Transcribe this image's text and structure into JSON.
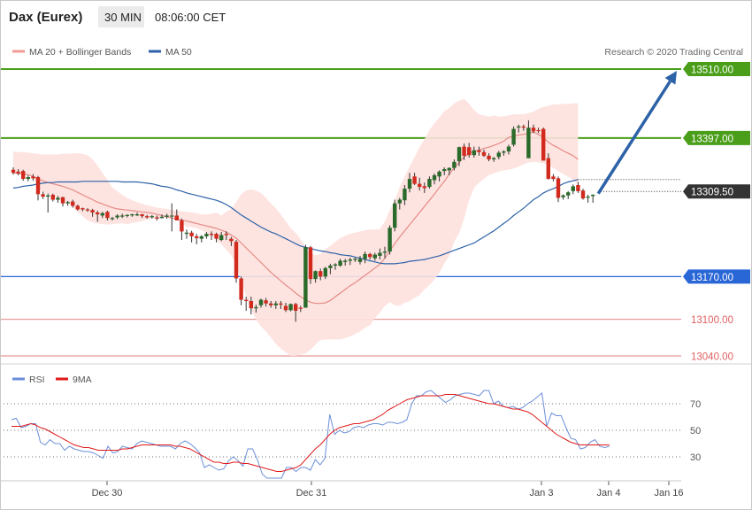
{
  "header": {
    "symbol": "Dax (Eurex)",
    "interval": "30 MIN",
    "time": "08:06:00 CET"
  },
  "legend": {
    "bollinger_label": "MA 20 + Bollinger Bands",
    "ma50_label": "MA 50",
    "credit": "Research © 2020 Trading Central"
  },
  "colors": {
    "bullish": "#2a6a2a",
    "bearish": "#d32a1e",
    "band_fill": "#fde1de",
    "ma20": "#e68a85",
    "ma50": "#2d62a8",
    "target_line": "#4a9e1a",
    "support_line": "#2a67d6",
    "lower_line": "#e89b98",
    "arrow": "#2d62a8",
    "rsi": "#6b8fd8",
    "rsi_ma": "#e01a1a"
  },
  "price_levels": [
    {
      "label": "13510.00",
      "value": 13510,
      "style": "target"
    },
    {
      "label": "13397.00",
      "value": 13397,
      "style": "target"
    },
    {
      "label": "13309.50",
      "value": 13309.5,
      "style": "last"
    },
    {
      "label": "13170.00",
      "value": 13170,
      "style": "support"
    },
    {
      "label": "13100.00",
      "value": 13100,
      "style": "lower"
    },
    {
      "label": "13040.00",
      "value": 13040,
      "style": "lower"
    }
  ],
  "rsi_panel": {
    "rsi_label": "RSI",
    "ma_label": "9MA",
    "ticks": [
      "70",
      "50",
      "30"
    ]
  },
  "x_axis": {
    "labels": [
      "Dec 30",
      "Dec 31",
      "Jan 3",
      "Jan 4",
      "Jan 16"
    ]
  },
  "chart_data": {
    "type": "candlestick",
    "price_range": [
      13025,
      13530
    ],
    "rsi_range": [
      10,
      90
    ],
    "ohlc": [
      [
        13345,
        13349,
        13337,
        13340
      ],
      [
        13342,
        13346,
        13336,
        13339
      ],
      [
        13343,
        13345,
        13327,
        13330
      ],
      [
        13330,
        13336,
        13326,
        13333
      ],
      [
        13334,
        13338,
        13327,
        13331
      ],
      [
        13333,
        13335,
        13295,
        13305
      ],
      [
        13305,
        13309,
        13297,
        13301
      ],
      [
        13301,
        13306,
        13275,
        13303
      ],
      [
        13304,
        13306,
        13293,
        13296
      ],
      [
        13296,
        13302,
        13291,
        13299
      ],
      [
        13300,
        13301,
        13285,
        13290
      ],
      [
        13290,
        13294,
        13286,
        13292
      ],
      [
        13293,
        13296,
        13283,
        13286
      ],
      [
        13286,
        13288,
        13278,
        13280
      ],
      [
        13282,
        13283,
        13277,
        13280
      ],
      [
        13280,
        13282,
        13276,
        13279
      ],
      [
        13279,
        13281,
        13268,
        13275
      ],
      [
        13275,
        13278,
        13260,
        13272
      ],
      [
        13270,
        13276,
        13266,
        13274
      ],
      [
        13276,
        13278,
        13262,
        13266
      ],
      [
        13265,
        13268,
        13262,
        13266
      ],
      [
        13267,
        13272,
        13264,
        13270
      ],
      [
        13270,
        13273,
        13266,
        13270
      ],
      [
        13270,
        13272,
        13267,
        13271
      ],
      [
        13271,
        13273,
        13268,
        13272
      ],
      [
        13272,
        13275,
        13269,
        13272
      ],
      [
        13272,
        13273,
        13266,
        13269
      ],
      [
        13269,
        13271,
        13265,
        13267
      ],
      [
        13268,
        13271,
        13265,
        13269
      ],
      [
        13267,
        13270,
        13262,
        13265
      ],
      [
        13266,
        13272,
        13265,
        13268
      ],
      [
        13268,
        13273,
        13265,
        13270
      ],
      [
        13270,
        13290,
        13244,
        13270
      ],
      [
        13270,
        13280,
        13262,
        13262
      ],
      [
        13262,
        13265,
        13230,
        13244
      ],
      [
        13240,
        13247,
        13232,
        13242
      ],
      [
        13242,
        13245,
        13226,
        13236
      ],
      [
        13236,
        13240,
        13223,
        13233
      ],
      [
        13232,
        13238,
        13226,
        13236
      ],
      [
        13236,
        13243,
        13232,
        13240
      ],
      [
        13240,
        13244,
        13230,
        13238
      ],
      [
        13240,
        13242,
        13226,
        13232
      ],
      [
        13230,
        13243,
        13228,
        13238
      ],
      [
        13240,
        13244,
        13230,
        13238
      ],
      [
        13232,
        13235,
        13220,
        13228
      ],
      [
        13227,
        13230,
        13160,
        13167
      ],
      [
        13167,
        13170,
        13123,
        13132
      ],
      [
        13132,
        13137,
        13114,
        13130
      ],
      [
        13130,
        13137,
        13108,
        13118
      ],
      [
        13118,
        13124,
        13111,
        13120
      ],
      [
        13123,
        13134,
        13119,
        13132
      ],
      [
        13131,
        13135,
        13121,
        13126
      ],
      [
        13126,
        13130,
        13119,
        13123
      ],
      [
        13123,
        13130,
        13117,
        13126
      ],
      [
        13126,
        13130,
        13117,
        13124
      ],
      [
        13122,
        13127,
        13112,
        13115
      ],
      [
        13115,
        13126,
        13113,
        13125
      ],
      [
        13125,
        13127,
        13096,
        13114
      ],
      [
        13119,
        13122,
        13112,
        13118
      ],
      [
        13119,
        13222,
        13119,
        13218
      ],
      [
        13218,
        13220,
        13158,
        13166
      ],
      [
        13166,
        13180,
        13160,
        13179
      ],
      [
        13179,
        13183,
        13164,
        13170
      ],
      [
        13170,
        13186,
        13166,
        13184
      ],
      [
        13184,
        13191,
        13174,
        13188
      ],
      [
        13188,
        13192,
        13181,
        13190
      ],
      [
        13188,
        13199,
        13186,
        13196
      ],
      [
        13194,
        13199,
        13188,
        13196
      ],
      [
        13196,
        13201,
        13189,
        13198
      ],
      [
        13198,
        13201,
        13194,
        13199
      ],
      [
        13194,
        13204,
        13190,
        13199
      ],
      [
        13199,
        13211,
        13192,
        13207
      ],
      [
        13207,
        13209,
        13198,
        13202
      ],
      [
        13200,
        13209,
        13196,
        13206
      ],
      [
        13204,
        13216,
        13198,
        13209
      ],
      [
        13209,
        13219,
        13200,
        13211
      ],
      [
        13211,
        13254,
        13206,
        13250
      ],
      [
        13250,
        13296,
        13244,
        13290
      ],
      [
        13290,
        13299,
        13280,
        13296
      ],
      [
        13295,
        13320,
        13287,
        13314
      ],
      [
        13314,
        13340,
        13308,
        13330
      ],
      [
        13334,
        13340,
        13320,
        13322
      ],
      [
        13322,
        13332,
        13311,
        13317
      ],
      [
        13318,
        13324,
        13307,
        13315
      ],
      [
        13317,
        13334,
        13314,
        13330
      ],
      [
        13328,
        13339,
        13321,
        13336
      ],
      [
        13334,
        13344,
        13326,
        13342
      ],
      [
        13343,
        13349,
        13336,
        13346
      ],
      [
        13344,
        13349,
        13336,
        13348
      ],
      [
        13348,
        13362,
        13344,
        13358
      ],
      [
        13359,
        13383,
        13351,
        13382
      ],
      [
        13383,
        13388,
        13361,
        13368
      ],
      [
        13382,
        13389,
        13365,
        13369
      ],
      [
        13369,
        13383,
        13365,
        13377
      ],
      [
        13377,
        13383,
        13368,
        13374
      ],
      [
        13374,
        13378,
        13366,
        13368
      ],
      [
        13368,
        13372,
        13359,
        13362
      ],
      [
        13362,
        13366,
        13358,
        13364
      ],
      [
        13366,
        13376,
        13362,
        13373
      ],
      [
        13373,
        13377,
        13368,
        13375
      ],
      [
        13375,
        13386,
        13370,
        13383
      ],
      [
        13386,
        13416,
        13383,
        13412
      ],
      [
        13416,
        13419,
        13406,
        13416
      ],
      [
        13416,
        13419,
        13409,
        13414
      ],
      [
        13364,
        13426,
        13364,
        13414
      ],
      [
        13414,
        13419,
        13405,
        13408
      ],
      [
        13410,
        13414,
        13405,
        13409
      ],
      [
        13412,
        13414,
        13392,
        13360
      ],
      [
        13364,
        13372,
        13329,
        13330
      ],
      [
        13334,
        13338,
        13326,
        13330
      ],
      [
        13331,
        13334,
        13292,
        13299
      ],
      [
        13300,
        13305,
        13296,
        13303
      ],
      [
        13303,
        13310,
        13297,
        13308
      ],
      [
        13310,
        13321,
        13305,
        13318
      ],
      [
        13320,
        13325,
        13307,
        13310
      ],
      [
        13311,
        13314,
        13296,
        13298
      ],
      [
        13300,
        13304,
        13291,
        13301
      ],
      [
        13302,
        13305,
        13291,
        13304
      ]
    ],
    "ma20": [
      13340,
      13339,
      13338,
      13337,
      13334,
      13330,
      13327,
      13324,
      13322,
      13320,
      13318,
      13315,
      13312,
      13308,
      13304,
      13300,
      13296,
      13292,
      13289,
      13286,
      13283,
      13281,
      13280,
      13279,
      13278,
      13277,
      13276,
      13275,
      13274,
      13272,
      13270,
      13268,
      13266,
      13264,
      13263,
      13261,
      13259,
      13257,
      13255,
      13253,
      13251,
      13249,
      13246,
      13243,
      13238,
      13233,
      13225,
      13217,
      13209,
      13201,
      13193,
      13185,
      13177,
      13170,
      13163,
      13156,
      13150,
      13143,
      13137,
      13132,
      13128,
      13126,
      13126,
      13127,
      13131,
      13137,
      13143,
      13149,
      13155,
      13160,
      13166,
      13172,
      13178,
      13184,
      13190,
      13200,
      13212,
      13224,
      13235,
      13245,
      13255,
      13265,
      13275,
      13285,
      13295,
      13305,
      13316,
      13326,
      13338,
      13348,
      13357,
      13366,
      13372,
      13375,
      13377,
      13380,
      13382,
      13385,
      13388,
      13392,
      13398,
      13400,
      13402,
      13403,
      13405,
      13407,
      13403,
      13398,
      13390,
      13385,
      13381,
      13376,
      13372,
      13368,
      13362
    ],
    "band_upper": [
      13375,
      13374,
      13374,
      13373,
      13372,
      13371,
      13370,
      13370,
      13370,
      13370,
      13371,
      13371,
      13372,
      13372,
      13371,
      13369,
      13362,
      13352,
      13340,
      13328,
      13316,
      13310,
      13304,
      13299,
      13295,
      13292,
      13289,
      13287,
      13285,
      13283,
      13282,
      13281,
      13279,
      13278,
      13277,
      13276,
      13275,
      13274,
      13272,
      13272,
      13273,
      13275,
      13270,
      13276,
      13281,
      13292,
      13305,
      13311,
      13313,
      13311,
      13307,
      13299,
      13290,
      13282,
      13272,
      13261,
      13249,
      13242,
      13231,
      13218,
      13209,
      13205,
      13207,
      13215,
      13220,
      13227,
      13233,
      13237,
      13240,
      13242,
      13244,
      13246,
      13247,
      13247,
      13248,
      13260,
      13279,
      13295,
      13317,
      13334,
      13350,
      13366,
      13382,
      13395,
      13410,
      13421,
      13431,
      13441,
      13446,
      13454,
      13458,
      13461,
      13453,
      13443,
      13436,
      13434,
      13432,
      13434,
      13432,
      13433,
      13434,
      13436,
      13436,
      13436,
      13438,
      13440,
      13445,
      13448,
      13450,
      13452,
      13452,
      13453,
      13453,
      13454,
      13454
    ],
    "band_lower": [
      13340,
      13339,
      13339,
      13338,
      13333,
      13318,
      13306,
      13305,
      13302,
      13298,
      13293,
      13291,
      13284,
      13276,
      13269,
      13262,
      13259,
      13257,
      13256,
      13255,
      13256,
      13257,
      13257,
      13256,
      13258,
      13259,
      13261,
      13263,
      13265,
      13265,
      13266,
      13267,
      13268,
      13265,
      13258,
      13251,
      13251,
      13249,
      13246,
      13241,
      13237,
      13230,
      13223,
      13214,
      13205,
      13190,
      13163,
      13138,
      13116,
      13100,
      13088,
      13080,
      13070,
      13060,
      13052,
      13046,
      13040,
      13040,
      13042,
      13044,
      13050,
      13059,
      13066,
      13067,
      13067,
      13067,
      13067,
      13069,
      13072,
      13076,
      13080,
      13086,
      13090,
      13102,
      13111,
      13122,
      13128,
      13123,
      13122,
      13127,
      13130,
      13135,
      13140,
      13149,
      13156,
      13165,
      13176,
      13191,
      13204,
      13227,
      13241,
      13265,
      13295,
      13315,
      13324,
      13330,
      13336,
      13339,
      13342,
      13344,
      13345,
      13347,
      13350,
      13354,
      13357,
      13358,
      13357,
      13356,
      13352,
      13348,
      13343,
      13338,
      13334,
      13328,
      13321
    ],
    "ma50": [
      13315,
      13316,
      13318,
      13319,
      13320,
      13322,
      13323,
      13324,
      13324,
      13325,
      13325,
      13325,
      13325,
      13325,
      13326,
      13326,
      13326,
      13326,
      13326,
      13326,
      13326,
      13326,
      13325,
      13325,
      13325,
      13325,
      13324,
      13323,
      13322,
      13320,
      13318,
      13317,
      13315,
      13312,
      13310,
      13307,
      13305,
      13303,
      13301,
      13299,
      13297,
      13295,
      13292,
      13288,
      13283,
      13277,
      13271,
      13266,
      13261,
      13256,
      13251,
      13247,
      13243,
      13240,
      13236,
      13232,
      13228,
      13224,
      13220,
      13218,
      13216,
      13214,
      13212,
      13211,
      13209,
      13208,
      13206,
      13205,
      13204,
      13202,
      13200,
      13198,
      13196,
      13194,
      13192,
      13191,
      13191,
      13191,
      13192,
      13193,
      13195,
      13196,
      13197,
      13198,
      13200,
      13202,
      13204,
      13207,
      13210,
      13213,
      13216,
      13219,
      13222,
      13225,
      13230,
      13235,
      13240,
      13245,
      13251,
      13257,
      13263,
      13270,
      13276,
      13282,
      13289,
      13296,
      13301,
      13307,
      13311,
      13314,
      13318,
      13322,
      13325,
      13327,
      13329
    ],
    "rsi": [
      58,
      59,
      52,
      53,
      55,
      55,
      41,
      39,
      43,
      40,
      40,
      35,
      38,
      36,
      35,
      34,
      34,
      33,
      31,
      29,
      38,
      33,
      34,
      38,
      37,
      36,
      40,
      42,
      41,
      40,
      39,
      38,
      38,
      38,
      36,
      40,
      42,
      40,
      37,
      33,
      22,
      24,
      22,
      20,
      21,
      27,
      30,
      27,
      23,
      36,
      36,
      28,
      17,
      14,
      14,
      14,
      14,
      22,
      22,
      19,
      22,
      22,
      20,
      28,
      24,
      29,
      62,
      47,
      50,
      48,
      49,
      52,
      53,
      52,
      54,
      55,
      55,
      54,
      56,
      56,
      55,
      56,
      58,
      70,
      76,
      76,
      79,
      80,
      77,
      74,
      71,
      73,
      76,
      77,
      78,
      78,
      77,
      76,
      80,
      80,
      70,
      72,
      68,
      67,
      68,
      66,
      67,
      70,
      72,
      75,
      78,
      53,
      63,
      61,
      61,
      52,
      44,
      43,
      36,
      37,
      41,
      43,
      38,
      37,
      38
    ],
    "rsi_ma": [
      53,
      53,
      53,
      54,
      55,
      54,
      52,
      51,
      49,
      47,
      45,
      43,
      41,
      39,
      38,
      37,
      37,
      36,
      35,
      35,
      35,
      35,
      35,
      36,
      36,
      37,
      38,
      39,
      39,
      39,
      39,
      39,
      39,
      39,
      38,
      38,
      37,
      36,
      34,
      32,
      30,
      28,
      26,
      26,
      25,
      25,
      26,
      26,
      25,
      25,
      24,
      23,
      22,
      21,
      20,
      19,
      19,
      20,
      21,
      22,
      24,
      28,
      32,
      36,
      39,
      43,
      47,
      50,
      52,
      53,
      54,
      55,
      55,
      56,
      57,
      58,
      60,
      62,
      65,
      67,
      69,
      71,
      73,
      74,
      75,
      76,
      76,
      76,
      76,
      76,
      77,
      77,
      77,
      76,
      75,
      74,
      73,
      72,
      71,
      70,
      70,
      69,
      68,
      67,
      66,
      66,
      65,
      64,
      62,
      59,
      56,
      53,
      50,
      47,
      45,
      43,
      41,
      40,
      39,
      39,
      39,
      39,
      39,
      39,
      39
    ],
    "target_arrow": {
      "from": 13306,
      "to": 13510
    },
    "rsi_guides": [
      70,
      50,
      30
    ]
  }
}
